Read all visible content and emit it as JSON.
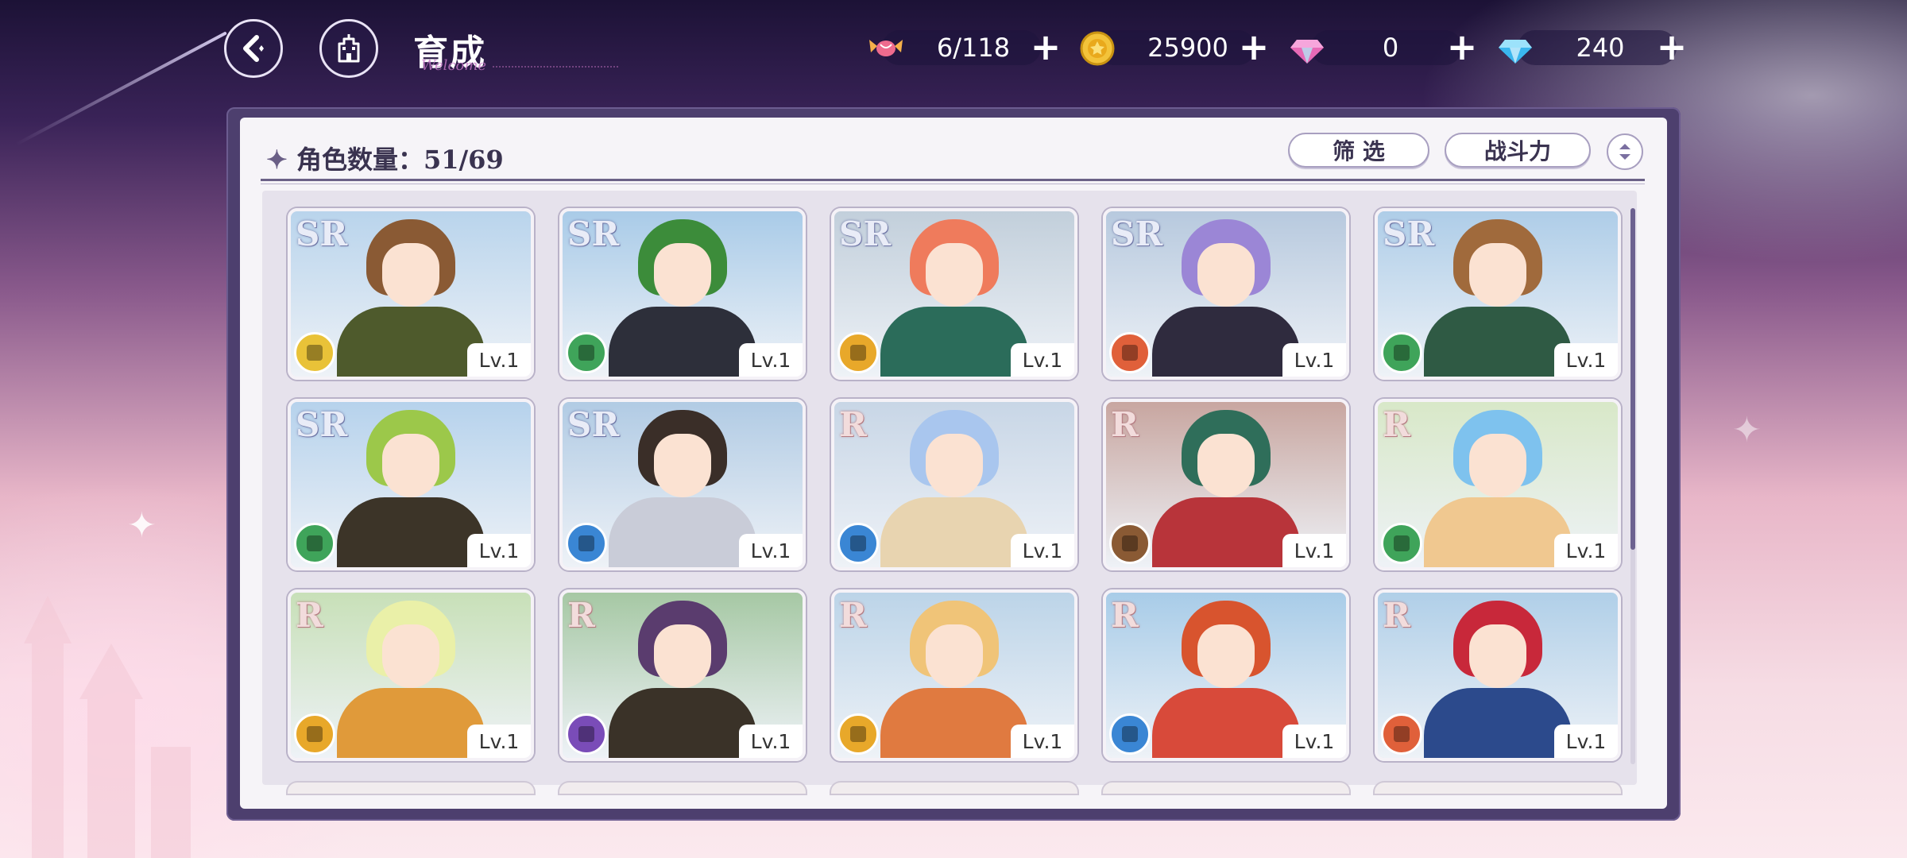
{
  "header": {
    "title": "育成",
    "title_deco": "Welcome"
  },
  "resources": [
    {
      "icon": "candy-icon",
      "value": "6/118"
    },
    {
      "icon": "gold-coin-icon",
      "value": "25900"
    },
    {
      "icon": "pink-gem-icon",
      "value": "0"
    },
    {
      "icon": "blue-diamond-icon",
      "value": "240"
    }
  ],
  "panel": {
    "count_label": "角色数量：51/69",
    "filter_label": "筛 选",
    "sort_label": "战斗力"
  },
  "cards": [
    {
      "rarity": "SR",
      "level": "Lv.1",
      "class_color": "#e9c238",
      "hair": "#8a5a34",
      "outfit": "#4e5a2c",
      "sky": "#b9d4ec"
    },
    {
      "rarity": "SR",
      "level": "Lv.1",
      "class_color": "#3fa45a",
      "hair": "#3c8c3a",
      "outfit": "#2d2f3a",
      "sky": "#a9cbe8"
    },
    {
      "rarity": "SR",
      "level": "Lv.1",
      "class_color": "#e8a82a",
      "hair": "#ef7b5c",
      "outfit": "#2b6c5a",
      "sky": "#c2cfdb"
    },
    {
      "rarity": "SR",
      "level": "Lv.1",
      "class_color": "#e0603a",
      "hair": "#9b86d6",
      "outfit": "#2f2b3e",
      "sky": "#b7c9de"
    },
    {
      "rarity": "SR",
      "level": "Lv.1",
      "class_color": "#3fa45a",
      "hair": "#a06a3c",
      "outfit": "#2f5a44",
      "sky": "#aecde8"
    },
    {
      "rarity": "SR",
      "level": "Lv.1",
      "class_color": "#3fa45a",
      "hair": "#9cc84a",
      "outfit": "#3c3428",
      "sky": "#b6d2ec"
    },
    {
      "rarity": "SR",
      "level": "Lv.1",
      "class_color": "#3a86d4",
      "hair": "#3a2e28",
      "outfit": "#c9ccd8",
      "sky": "#b1cbe4"
    },
    {
      "rarity": "R",
      "level": "Lv.1",
      "class_color": "#3a86d4",
      "hair": "#a9c6ee",
      "outfit": "#e8d4b0",
      "sky": "#c8d6e6"
    },
    {
      "rarity": "R",
      "level": "Lv.1",
      "class_color": "#8a5a34",
      "hair": "#2f6e5a",
      "outfit": "#b8343a",
      "sky": "#c8a6a0"
    },
    {
      "rarity": "R",
      "level": "Lv.1",
      "class_color": "#3fa45a",
      "hair": "#7ec2ee",
      "outfit": "#f0c890",
      "sky": "#d8e8c8"
    },
    {
      "rarity": "R",
      "level": "Lv.1",
      "class_color": "#e8a82a",
      "hair": "#eaf0a8",
      "outfit": "#e09a3a",
      "sky": "#c8e0b8"
    },
    {
      "rarity": "R",
      "level": "Lv.1",
      "class_color": "#7a4cb8",
      "hair": "#5a3c6e",
      "outfit": "#3a3228",
      "sky": "#a6c8a4"
    },
    {
      "rarity": "R",
      "level": "Lv.1",
      "class_color": "#e8a82a",
      "hair": "#f0c478",
      "outfit": "#e07a40",
      "sky": "#bcd4e8"
    },
    {
      "rarity": "R",
      "level": "Lv.1",
      "class_color": "#3a86d4",
      "hair": "#d8542e",
      "outfit": "#d84a3a",
      "sky": "#a8cce8"
    },
    {
      "rarity": "R",
      "level": "Lv.1",
      "class_color": "#e0603a",
      "hair": "#c8283a",
      "outfit": "#2c4a8c",
      "sky": "#b0cfe8"
    }
  ]
}
